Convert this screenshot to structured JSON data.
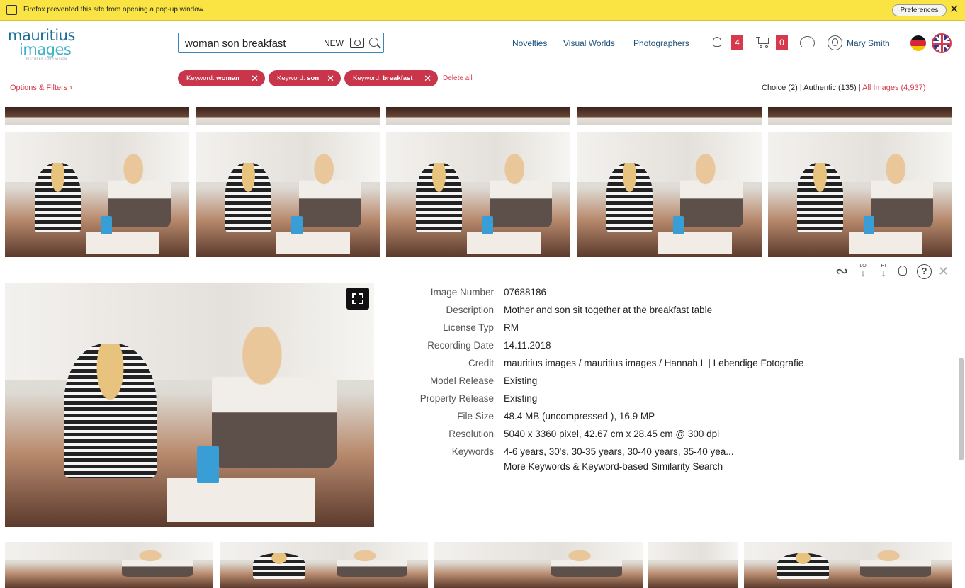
{
  "browser": {
    "popup_message": "Firefox prevented this site from opening a pop-up window.",
    "preferences_label": "Preferences",
    "close_glyph": "✕"
  },
  "logo": {
    "line1": "mauritius",
    "line2": "images",
    "tagline": "PICTURES YOUR VISION"
  },
  "search": {
    "value": "woman son breakfast",
    "new_label": "NEW"
  },
  "nav": {
    "novelties": "Novelties",
    "visual_worlds": "Visual Worlds",
    "photographers": "Photographers",
    "lightbox_count": "4",
    "cart_count": "0",
    "user_name": "Mary Smith"
  },
  "filters": {
    "chips": [
      {
        "prefix": "Keyword:",
        "value": "woman"
      },
      {
        "prefix": "Keyword:",
        "value": "son"
      },
      {
        "prefix": "Keyword:",
        "value": "breakfast"
      }
    ],
    "delete_all": "Delete all",
    "options": "Options & Filters ›",
    "choice": "Choice (2)",
    "authentic": "Authentic (135)",
    "all_images": "All Images (4,937)",
    "separator": "|"
  },
  "detail": {
    "tools": {
      "lo": "LO",
      "hi": "HI",
      "help": "?",
      "close": "✕",
      "similar": "∾"
    },
    "rows": [
      {
        "label": "Image Number",
        "value": "07688186"
      },
      {
        "label": "Description",
        "value": "Mother and son sit together at the breakfast table"
      },
      {
        "label": "License Typ",
        "value": "RM"
      },
      {
        "label": "Recording Date",
        "value": "14.11.2018"
      },
      {
        "label": "Credit",
        "value": "mauritius images / mauritius images / Hannah L | Lebendige Fotografie"
      },
      {
        "label": "Model Release",
        "value": "Existing"
      },
      {
        "label": "Property Release",
        "value": "Existing"
      },
      {
        "label": "File Size",
        "value": "48.4 MB (uncompressed ), 16.9 MP"
      },
      {
        "label": "Resolution",
        "value": "5040 x 3360 pixel, 42.67 cm x 28.45 cm @ 300 dpi"
      },
      {
        "label": "Keywords",
        "value": "4-6 years, 30's, 30-35 years, 30-40 years, 35-40 yea..."
      }
    ],
    "more_keywords": "More Keywords & Keyword-based Similarity Search"
  },
  "colors": {
    "accent": "#d6394b",
    "popup_bg": "#f9e443",
    "nav_text": "#1b4f7a",
    "logo_dark": "#1b6e9b",
    "logo_light": "#3eb1c7"
  }
}
